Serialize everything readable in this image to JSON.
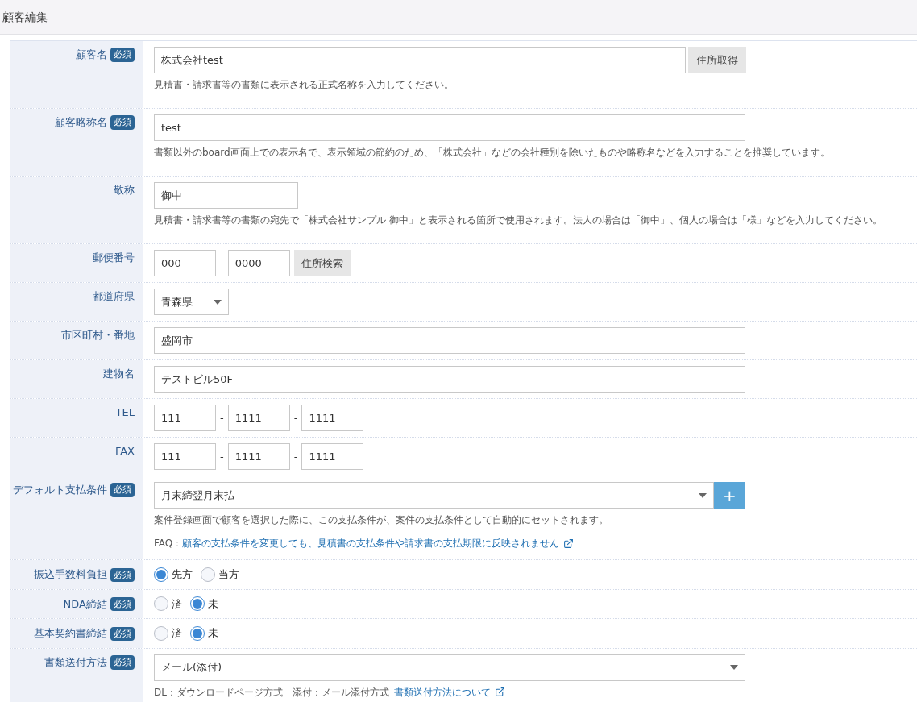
{
  "page": {
    "title": "顧客編集"
  },
  "rows": [
    {
      "kind": "text_button",
      "label": "顧客名",
      "badge": "必須",
      "value": "株式会社test",
      "button": "住所取得",
      "help": "見積書・請求書等の書類に表示される正式名称を入力してください。"
    },
    {
      "kind": "text",
      "label": "顧客略称名",
      "badge": "必須",
      "value": "test",
      "help": "書類以外のboard画面上での表示名で、表示領域の節約のため、「株式会社」などの会社種別を除いたものや略称名などを入力することを推奨しています。"
    },
    {
      "kind": "short_text",
      "label": "敬称",
      "value": "御中",
      "help": "見積書・請求書等の書類の宛先で「株式会社サンプル 御中」と表示される箇所で使用されます。法人の場合は「御中」、個人の場合は「様」などを入力してください。"
    },
    {
      "kind": "postal",
      "label": "郵便番号",
      "values": [
        "000",
        "0000"
      ],
      "separators": [
        "-"
      ],
      "button": "住所検索"
    },
    {
      "kind": "select_short",
      "label": "都道府県",
      "value": "青森県"
    },
    {
      "kind": "text",
      "label": "市区町村・番地",
      "value": "盛岡市"
    },
    {
      "kind": "text",
      "label": "建物名",
      "value": "テストビル50F"
    },
    {
      "kind": "phone",
      "label": "TEL",
      "values": [
        "111",
        "1111",
        "1111"
      ],
      "separators": [
        "-",
        "-"
      ]
    },
    {
      "kind": "phone",
      "label": "FAX",
      "values": [
        "111",
        "1111",
        "1111"
      ],
      "separators": [
        "-",
        "-"
      ]
    },
    {
      "kind": "select_add",
      "label": "デフォルト支払条件",
      "badge": "必須",
      "value": "月末締翌月末払",
      "button": "+",
      "help": "案件登録画面で顧客を選択した際に、この支払条件が、案件の支払条件として自動的にセットされます。",
      "faq": {
        "prefix": "FAQ：",
        "link": "顧客の支払条件を変更しても、見積書の支払条件や請求書の支払期限に反映されません"
      }
    },
    {
      "kind": "radio",
      "label": "振込手数料負担",
      "badge": "必須",
      "options": [
        {
          "label": "先方",
          "selected": true
        },
        {
          "label": "当方",
          "selected": false
        }
      ]
    },
    {
      "kind": "radio",
      "label": "NDA締結",
      "badge": "必須",
      "options": [
        {
          "label": "済",
          "selected": false
        },
        {
          "label": "未",
          "selected": true
        }
      ]
    },
    {
      "kind": "radio",
      "label": "基本契約書締結",
      "badge": "必須",
      "options": [
        {
          "label": "済",
          "selected": false
        },
        {
          "label": "未",
          "selected": true
        }
      ]
    },
    {
      "kind": "select",
      "label": "書類送付方法",
      "badge": "必須",
      "value": "メール(添付)",
      "notes": [
        "DL：ダウンロードページ方式",
        "添付：メール添付方式"
      ],
      "link": "書類送付方法について"
    }
  ]
}
